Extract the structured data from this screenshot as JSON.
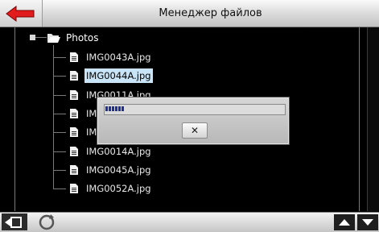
{
  "header": {
    "title": "Менеджер файлов",
    "back_icon": "arrow-left-icon"
  },
  "tree": {
    "folder": {
      "label": "Photos",
      "icon": "folder-open-icon"
    },
    "files": [
      {
        "label": "IMG0043A.jpg",
        "selected": false
      },
      {
        "label": "IMG0044A.jpg",
        "selected": true
      },
      {
        "label": "IMG0011A.jpg",
        "selected": false
      },
      {
        "label": "IM",
        "selected": false
      },
      {
        "label": "IM",
        "selected": false
      },
      {
        "label": "IMG0014A.jpg",
        "selected": false
      },
      {
        "label": "IMG0045A.jpg",
        "selected": false
      },
      {
        "label": "IMG0052A.jpg",
        "selected": false
      }
    ]
  },
  "dialog": {
    "progress_fraction": 0.11,
    "close_label": "✕",
    "accent": "#1f2f9a"
  },
  "footer": {
    "icons": [
      "exit-icon",
      "refresh-icon",
      "scroll-up-icon",
      "scroll-down-icon"
    ]
  }
}
